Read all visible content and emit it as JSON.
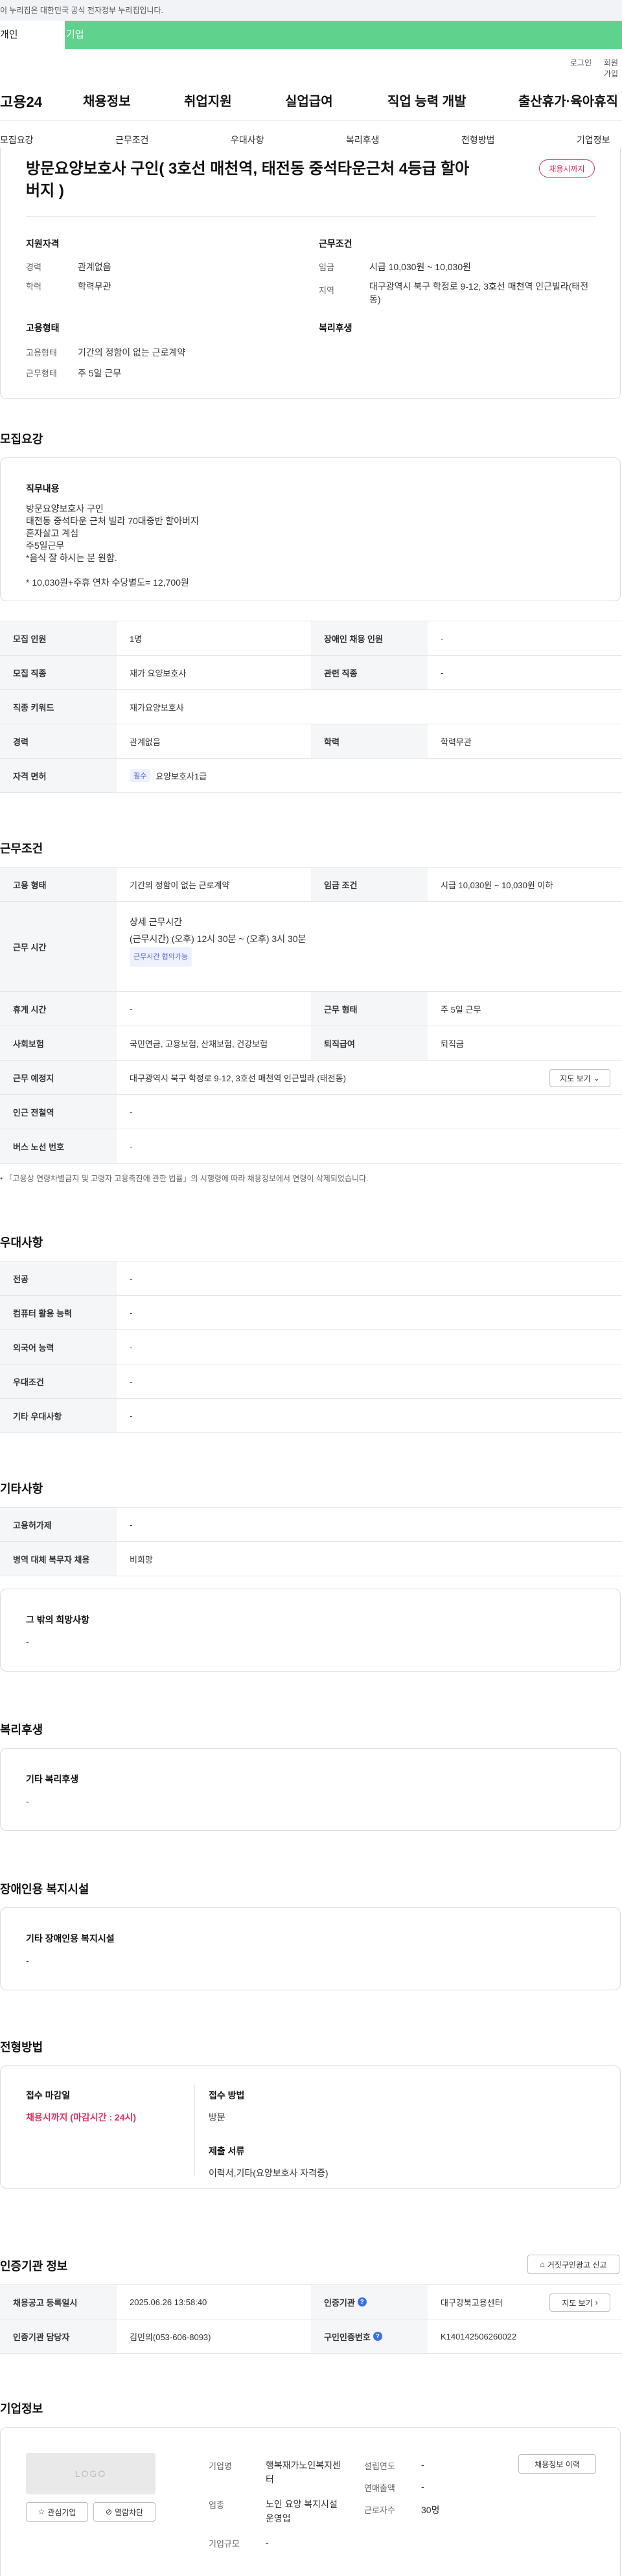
{
  "gov_banner": "이 누리집은 대한민국 공식 전자정부 누리집입니다.",
  "top_tabs": {
    "individual": "개인",
    "company": "기업"
  },
  "util": {
    "login": "로그인",
    "signup": "회원가입"
  },
  "gnb": {
    "logo": "고용24",
    "items": [
      "채용정보",
      "취업지원",
      "실업급여",
      "직업 능력 개발",
      "출산휴가·육아휴직"
    ]
  },
  "anchor_nav": [
    "모집요강",
    "근무조건",
    "우대사항",
    "복리후생",
    "전형방법",
    "기업정보"
  ],
  "job": {
    "title": "방문요양보호사 구인( 3호선 매천역, 태전동 중석타운근처 4등급 할아버지 )",
    "deadline_badge": "채용시까지"
  },
  "summary": {
    "qual_title": "지원자격",
    "career_label": "경력",
    "career_value": "관계없음",
    "edu_label": "학력",
    "edu_value": "학력무관",
    "cond_title": "근무조건",
    "wage_label": "임금",
    "wage_value": "시급 10,030원 ~ 10,030원",
    "region_label": "지역",
    "region_value": "대구광역시 북구 학정로 9-12, 3호선 매천역 인근빌라(태전동)",
    "emp_title": "고용형태",
    "emp_type_label": "고용형태",
    "emp_type_value": "기간의 정함이 없는 근로계약",
    "work_days_label": "근무형태",
    "work_days_value": "주 5일 근무",
    "welfare_title": "복리후생"
  },
  "recruit": {
    "section": "모집요강",
    "duty_title": "직무내용",
    "duty_lines": [
      "방문요양보호사 구인",
      "태전동 중석타운 근처 빌라 70대중반 할아버지",
      "혼자살고 계심",
      "주5일근무",
      "*음식 잘 하시는 분 원함.",
      "",
      "* 10,030원+주휴 연차 수당별도= 12,700원"
    ],
    "rows": [
      {
        "l1": "모집 인원",
        "v1": "1명",
        "l2": "장애인 채용 인원",
        "v2": "-"
      },
      {
        "l1": "모집 직종",
        "v1": "재가 요양보호사",
        "l2": "관련 직종",
        "v2": "-"
      },
      {
        "l1": "직종 키워드",
        "v1": "재가요양보호사"
      },
      {
        "l1": "경력",
        "v1": "관계없음",
        "l2": "학력",
        "v2": "학력무관"
      },
      {
        "l1": "자격 면허",
        "chip": "필수",
        "v1": "요양보호사1급"
      }
    ]
  },
  "conditions": {
    "section": "근무조건",
    "employment_label": "고용 형태",
    "employment_value": "기간의 정함이 없는 근로계약",
    "wage_label": "임금 조건",
    "wage_value": "시급 10,030원 ~ 10,030원 이하",
    "hours_label": "근무 시간",
    "hours_title": "상세 근무시간",
    "hours_value": "(근무시간) (오후) 12시 30분 ~ (오후) 3시 30분",
    "hours_chip": "근무시간 협의가능",
    "rest_label": "휴게 시간",
    "rest_value": "-",
    "type_label": "근무 형태",
    "type_value": "주 5일 근무",
    "insurance_label": "사회보험",
    "insurance_value": "국민연금, 고용보험, 산재보험, 건강보험",
    "retire_label": "퇴직급여",
    "retire_value": "퇴직금",
    "place_label": "근무 예정지",
    "place_value": "대구광역시 북구 학정로 9-12, 3호선 매천역 인근빌라 (태전동)",
    "map_btn": "지도 보기",
    "subway_label": "인근 전철역",
    "subway_value": "-",
    "bus_label": "버스 노선 번호",
    "bus_value": "-",
    "note": "「고용상 연령차별금지 및 고령자 고용촉진에 관한 법률」의 시행령에 따라 채용정보에서 연령이 삭제되었습니다."
  },
  "preferences": {
    "section": "우대사항",
    "rows": [
      [
        "전공",
        "-"
      ],
      [
        "컴퓨터 활용 능력",
        "-"
      ],
      [
        "외국어 능력",
        "-"
      ],
      [
        "우대조건",
        "-"
      ],
      [
        "기타 우대사항",
        "-"
      ]
    ]
  },
  "others": {
    "section": "기타사항",
    "rows": [
      [
        "고용허가제",
        "-"
      ],
      [
        "병역 대체 복무자 채용",
        "비희망"
      ]
    ],
    "wish_title": "그 밖의 희망사항",
    "wish_value": "-"
  },
  "welfare": {
    "section": "복리후생",
    "title": "기타 복리후생",
    "value": "-"
  },
  "disability": {
    "section": "장애인용 복지시설",
    "title": "기타 장애인용 복지시설",
    "value": "-"
  },
  "screening": {
    "section": "전형방법",
    "deadline_title": "접수 마감일",
    "deadline_value": "채용시까지 (마감시간 : 24시)",
    "method_title": "접수 방법",
    "method_value": "방문",
    "docs_title": "제출 서류",
    "docs_value": "이력서,기타(요양보호사 자격증)"
  },
  "certification": {
    "section": "인증기관 정보",
    "report_btn": "거짓구인광고 신고",
    "reg_label": "채용공고 등록일시",
    "reg_value": "2025.06.26 13:58:40",
    "org_label": "인증기관",
    "org_value": "대구강북고용센터",
    "map_btn": "지도 보기",
    "manager_label": "인증기관 담당자",
    "manager_value": "김민의(053-606-8093)",
    "no_label": "구인인증번호",
    "no_value": "K140142506260022"
  },
  "company": {
    "section": "기업정보",
    "logo": "LOGO",
    "fav_btn": "관심기업",
    "block_btn": "열람차단",
    "history_btn": "채용정보 이력",
    "name_label": "기업명",
    "name_value": "행복재가노인복지센터",
    "industry_label": "업종",
    "industry_value": "노인 요양 복지시설 운영업",
    "scale_label": "기업규모",
    "scale_value": "-",
    "founded_label": "설립연도",
    "founded_value": "-",
    "sales_label": "연매출액",
    "sales_value": "-",
    "employees_label": "근로자수",
    "employees_value": "30명"
  }
}
